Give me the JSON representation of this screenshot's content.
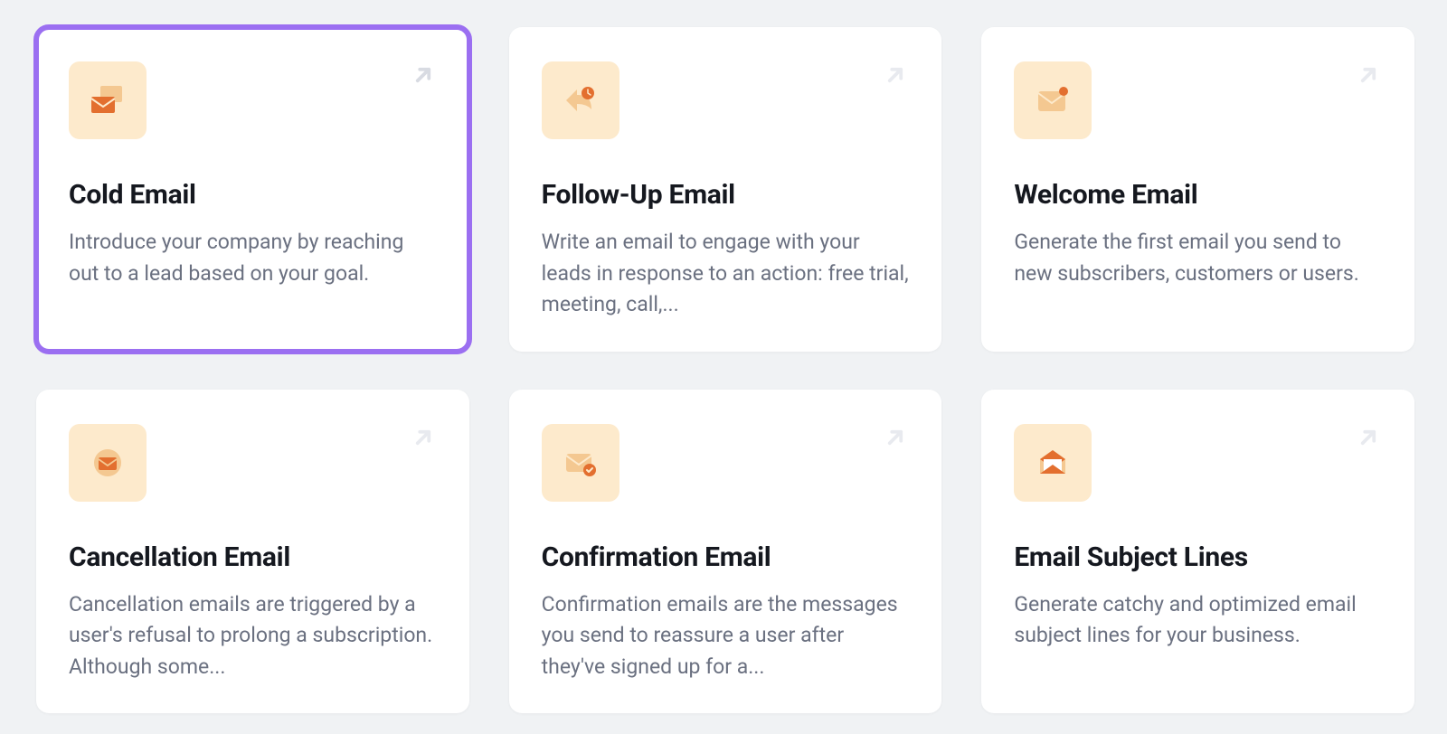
{
  "cards": [
    {
      "icon": "envelopes-icon",
      "title": "Cold Email",
      "description": "Introduce your company by reaching out to a lead based on your goal.",
      "selected": true
    },
    {
      "icon": "reply-clock-icon",
      "title": "Follow-Up Email",
      "description": "Write an email to engage with your leads in response to an action: free trial, meeting, call,...",
      "selected": false
    },
    {
      "icon": "envelope-dot-icon",
      "title": "Welcome Email",
      "description": "Generate the first email you send to new subscribers, customers or users.",
      "selected": false
    },
    {
      "icon": "envelope-solid-icon",
      "title": "Cancellation Email",
      "description": "Cancellation emails are triggered by a user's refusal to prolong a subscription. Although some...",
      "selected": false
    },
    {
      "icon": "envelope-check-icon",
      "title": "Confirmation Email",
      "description": "Confirmation emails are the messages you send to reassure a user after they've signed up for a...",
      "selected": false
    },
    {
      "icon": "envelope-open-icon",
      "title": "Email Subject Lines",
      "description": "Generate catchy and optimized email subject lines for your business.",
      "selected": false
    }
  ]
}
